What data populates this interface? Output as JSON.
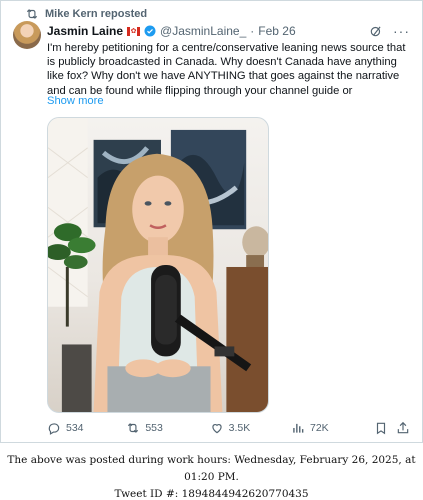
{
  "repost": {
    "label": "Mike Kern reposted"
  },
  "tweet": {
    "author_name": "Jasmin Laine",
    "handle": "@JasminLaine_",
    "separator": "·",
    "date": "Feb 26",
    "text": "I'm hereby petitioning for a centre/conservative leaning news source that is publicly broadcasted in Canada. Why doesn't Canada have anything like fox? Why don't we have ANYTHING that goes against the narrative and can be found while flipping through your channel guide or",
    "show_more": "Show more"
  },
  "actions": {
    "replies": "534",
    "reposts": "553",
    "likes": "3.5K",
    "views": "72K"
  },
  "footer": {
    "line1": "The above was posted during work hours: Wednesday, February 26, 2025, at 01:20 PM.",
    "line2": "Tweet ID #: 1894844942620770435"
  },
  "icons": {
    "repost": "repost-icon",
    "verified": "verified-badge-icon",
    "grok": "grok-icon",
    "more": "more-icon",
    "reply": "reply-icon",
    "like": "heart-icon",
    "views": "views-icon",
    "bookmark": "bookmark-icon",
    "share": "share-icon"
  },
  "colors": {
    "accent": "#1d9bf0",
    "muted": "#536471",
    "border": "#cfd9de"
  }
}
